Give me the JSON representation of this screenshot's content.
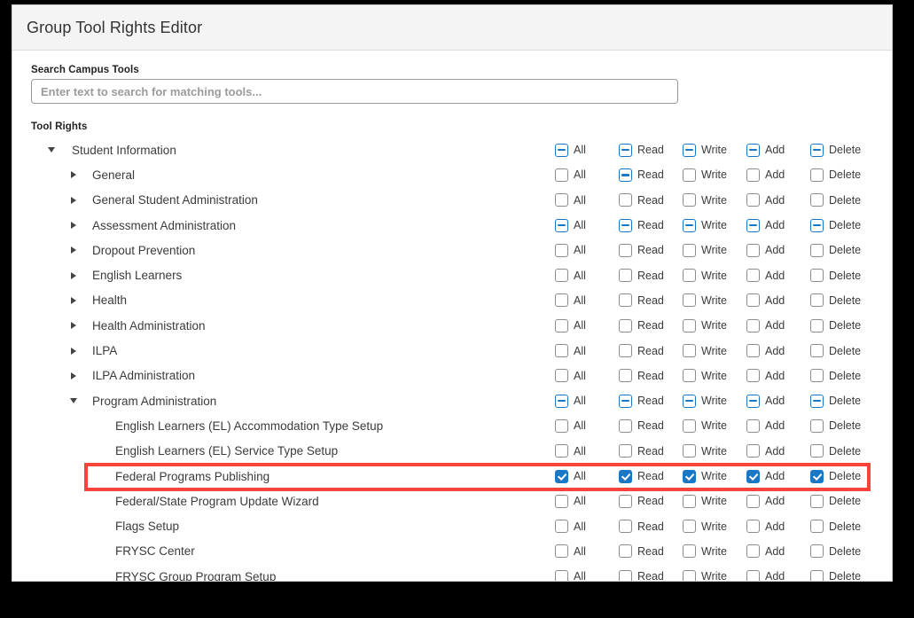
{
  "header": {
    "title": "Group Tool Rights Editor"
  },
  "search": {
    "label": "Search Campus Tools",
    "placeholder": "Enter text to search for matching tools...",
    "value": ""
  },
  "tool_rights": {
    "label": "Tool Rights",
    "permission_columns": [
      "All",
      "Read",
      "Write",
      "Add",
      "Delete"
    ],
    "rows": [
      {
        "label": "Student Information",
        "level": 1,
        "twisty": "expanded",
        "states": [
          "indeterminate",
          "indeterminate",
          "indeterminate",
          "indeterminate",
          "indeterminate"
        ],
        "highlighted": false
      },
      {
        "label": "General",
        "level": 2,
        "twisty": "collapsed",
        "states": [
          "unchecked",
          "indeterminate",
          "unchecked",
          "unchecked",
          "unchecked"
        ],
        "highlighted": false
      },
      {
        "label": "General Student Administration",
        "level": 2,
        "twisty": "collapsed",
        "states": [
          "unchecked",
          "unchecked",
          "unchecked",
          "unchecked",
          "unchecked"
        ],
        "highlighted": false
      },
      {
        "label": "Assessment Administration",
        "level": 2,
        "twisty": "collapsed",
        "states": [
          "indeterminate",
          "indeterminate",
          "indeterminate",
          "indeterminate",
          "indeterminate"
        ],
        "highlighted": false
      },
      {
        "label": "Dropout Prevention",
        "level": 2,
        "twisty": "collapsed",
        "states": [
          "unchecked",
          "unchecked",
          "unchecked",
          "unchecked",
          "unchecked"
        ],
        "highlighted": false
      },
      {
        "label": "English Learners",
        "level": 2,
        "twisty": "collapsed",
        "states": [
          "unchecked",
          "unchecked",
          "unchecked",
          "unchecked",
          "unchecked"
        ],
        "highlighted": false
      },
      {
        "label": "Health",
        "level": 2,
        "twisty": "collapsed",
        "states": [
          "unchecked",
          "unchecked",
          "unchecked",
          "unchecked",
          "unchecked"
        ],
        "highlighted": false
      },
      {
        "label": "Health Administration",
        "level": 2,
        "twisty": "collapsed",
        "states": [
          "unchecked",
          "unchecked",
          "unchecked",
          "unchecked",
          "unchecked"
        ],
        "highlighted": false
      },
      {
        "label": "ILPA",
        "level": 2,
        "twisty": "collapsed",
        "states": [
          "unchecked",
          "unchecked",
          "unchecked",
          "unchecked",
          "unchecked"
        ],
        "highlighted": false
      },
      {
        "label": "ILPA Administration",
        "level": 2,
        "twisty": "collapsed",
        "states": [
          "unchecked",
          "unchecked",
          "unchecked",
          "unchecked",
          "unchecked"
        ],
        "highlighted": false
      },
      {
        "label": "Program Administration",
        "level": 2,
        "twisty": "expanded",
        "states": [
          "indeterminate",
          "indeterminate",
          "indeterminate",
          "indeterminate",
          "indeterminate"
        ],
        "highlighted": false
      },
      {
        "label": "English Learners (EL) Accommodation Type Setup",
        "level": 3,
        "twisty": "none",
        "states": [
          "unchecked",
          "unchecked",
          "unchecked",
          "unchecked",
          "unchecked"
        ],
        "highlighted": false
      },
      {
        "label": "English Learners (EL) Service Type Setup",
        "level": 3,
        "twisty": "none",
        "states": [
          "unchecked",
          "unchecked",
          "unchecked",
          "unchecked",
          "unchecked"
        ],
        "highlighted": false
      },
      {
        "label": "Federal Programs Publishing",
        "level": 3,
        "twisty": "none",
        "states": [
          "checked",
          "checked",
          "checked",
          "checked",
          "checked"
        ],
        "highlighted": true
      },
      {
        "label": "Federal/State Program Update Wizard",
        "level": 3,
        "twisty": "none",
        "states": [
          "unchecked",
          "unchecked",
          "unchecked",
          "unchecked",
          "unchecked"
        ],
        "highlighted": false
      },
      {
        "label": "Flags Setup",
        "level": 3,
        "twisty": "none",
        "states": [
          "unchecked",
          "unchecked",
          "unchecked",
          "unchecked",
          "unchecked"
        ],
        "highlighted": false
      },
      {
        "label": "FRYSC Center",
        "level": 3,
        "twisty": "none",
        "states": [
          "unchecked",
          "unchecked",
          "unchecked",
          "unchecked",
          "unchecked"
        ],
        "highlighted": false
      },
      {
        "label": "FRYSC Group Program Setup",
        "level": 3,
        "twisty": "none",
        "states": [
          "unchecked",
          "unchecked",
          "unchecked",
          "unchecked",
          "unchecked"
        ],
        "highlighted": false
      }
    ]
  },
  "colors": {
    "accent_blue": "#1878c8",
    "highlight_red": "#f9443c",
    "header_bg": "#f4f4f4",
    "text": "#3b3b3b"
  }
}
